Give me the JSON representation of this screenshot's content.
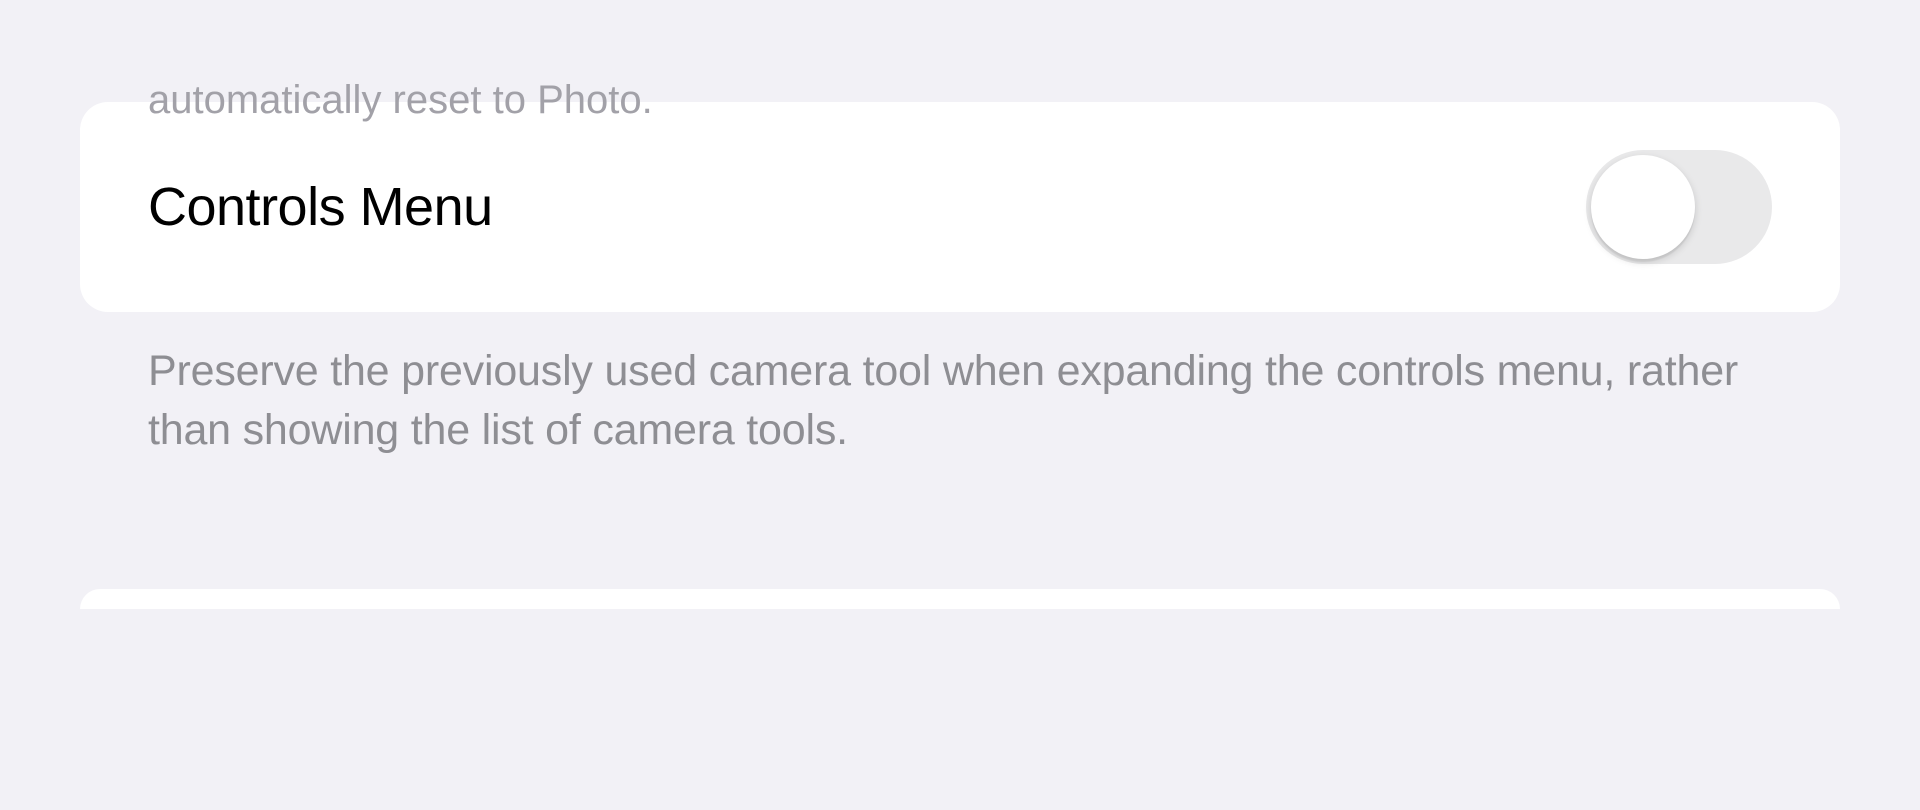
{
  "truncated_top_text": "automatically reset to Photo.",
  "setting": {
    "label": "Controls Menu",
    "description": "Preserve the previously used camera tool when expanding the controls menu, rather than showing the list of camera tools.",
    "toggle_on": false
  }
}
